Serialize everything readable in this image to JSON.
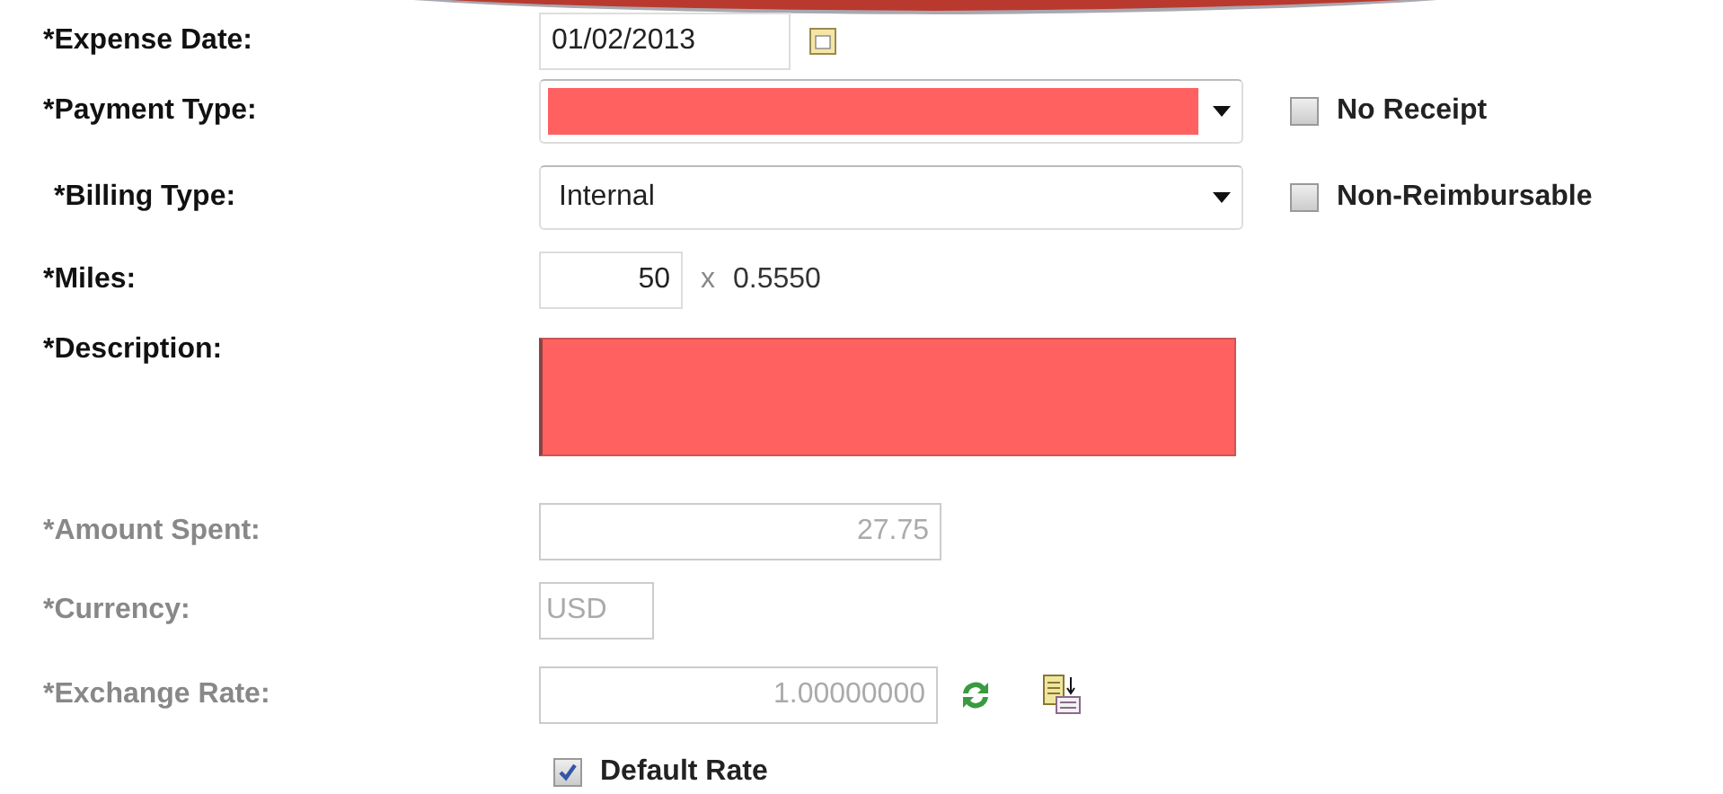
{
  "fields": [
    {
      "kind": "date",
      "label": "*Expense Date:",
      "disabled": false,
      "value": "01/02/2013"
    },
    {
      "kind": "select",
      "label": "*Payment Type:",
      "disabled": false,
      "error": true,
      "checkbox": {
        "label": "No Receipt",
        "checked": false
      }
    },
    {
      "kind": "select",
      "label": "*Billing Type:",
      "disabled": false,
      "error": false,
      "value": "Internal",
      "checkbox": {
        "label": "Non-Reimbursable",
        "checked": false
      }
    },
    {
      "kind": "miles",
      "label": "*Miles:",
      "disabled": false,
      "value": "50",
      "times": "x",
      "rate": "0.5550"
    },
    {
      "kind": "textarea",
      "label": "*Description:",
      "disabled": false,
      "error": true
    },
    {
      "kind": "amount",
      "label": "*Amount Spent:",
      "disabled": true,
      "value": "27.75"
    },
    {
      "kind": "currency",
      "label": "*Currency:",
      "disabled": true,
      "value": "USD"
    },
    {
      "kind": "rate",
      "label": "*Exchange Rate:",
      "disabled": true,
      "value": "1.00000000"
    }
  ],
  "default_rate": {
    "label": "Default Rate",
    "checked": true
  }
}
